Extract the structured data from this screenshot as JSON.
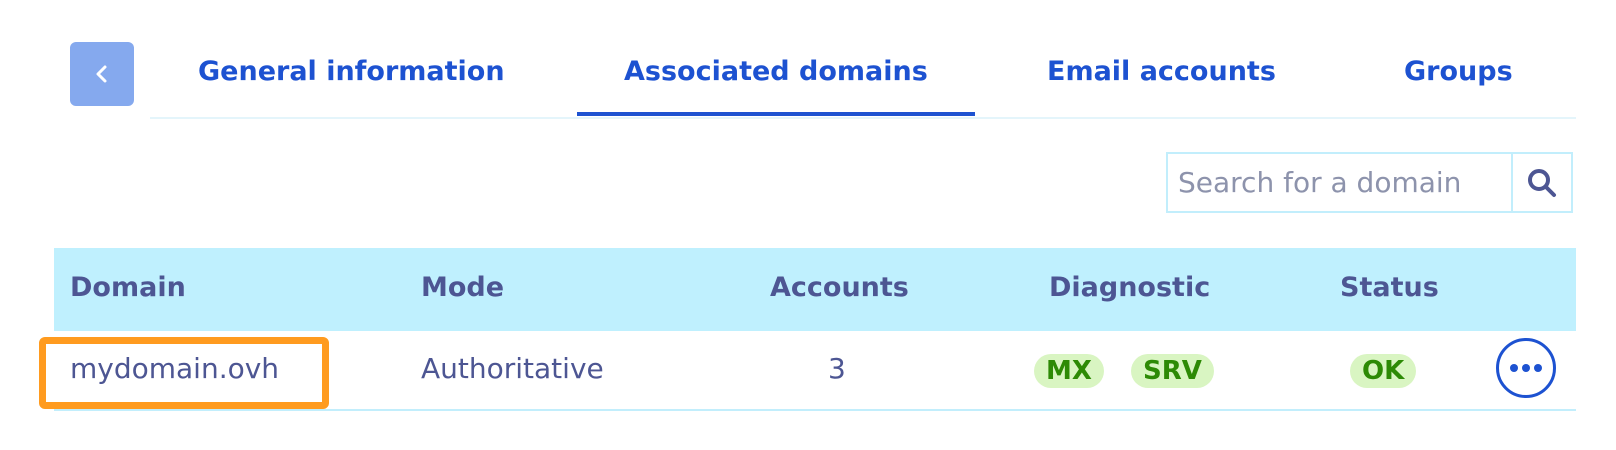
{
  "nav": {
    "back_icon": "chevron-left-icon"
  },
  "tabs": [
    {
      "label": "General information",
      "active": false
    },
    {
      "label": "Associated domains",
      "active": true
    },
    {
      "label": "Email accounts",
      "active": false
    },
    {
      "label": "Groups",
      "active": false
    }
  ],
  "search": {
    "placeholder": "Search for a domain",
    "value": "",
    "icon": "search-icon"
  },
  "table": {
    "columns": [
      "Domain",
      "Mode",
      "Accounts",
      "Diagnostic",
      "Status"
    ],
    "rows": [
      {
        "domain": "mydomain.ovh",
        "mode": "Authoritative",
        "accounts": "3",
        "diagnostics": [
          "MX",
          "SRV"
        ],
        "status": "OK",
        "actions_icon": "more-horizontal-icon",
        "highlighted": true
      }
    ]
  },
  "colors": {
    "accent": "#1d52d1",
    "header_bg": "#bff0fe",
    "badge_bg": "#d9f5c2",
    "badge_text": "#2d8a05",
    "highlight": "#ff9b1f"
  }
}
